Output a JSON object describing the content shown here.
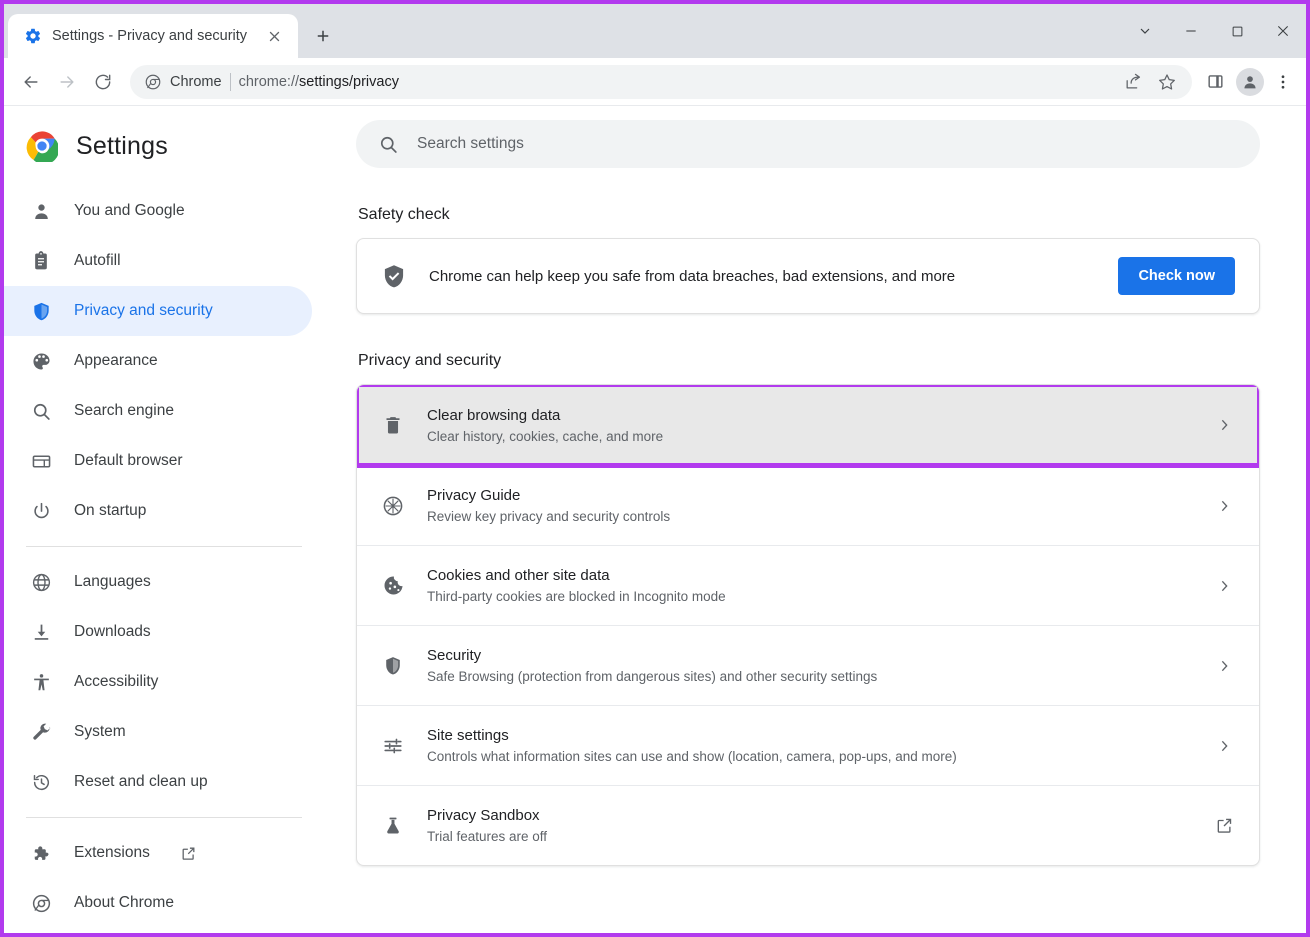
{
  "window": {
    "controls": [
      {
        "name": "tab-search-button",
        "glyph": "chevron-down-icon"
      },
      {
        "name": "minimize-button",
        "glyph": "minimize-icon"
      },
      {
        "name": "maximize-button",
        "glyph": "maximize-icon"
      },
      {
        "name": "close-window-button",
        "glyph": "close-icon"
      }
    ]
  },
  "tab": {
    "title": "Settings - Privacy and security",
    "favicon": "gear-icon",
    "close_label": "×",
    "newtab_label": "+"
  },
  "toolbar": {
    "back_label": "←",
    "forward_label": "→",
    "reload_label": "↻",
    "chip_label": "Chrome",
    "url_scheme": "chrome://",
    "url_path": "settings/privacy",
    "url_full": "chrome://settings/privacy",
    "icons": [
      "share-icon",
      "bookmark-star-icon",
      "side-panel-icon",
      "profile-avatar-icon",
      "more-menu-icon"
    ]
  },
  "sidebar": {
    "brand_title": "Settings",
    "brand_icon": "chrome-logo-icon",
    "groups": [
      {
        "items": [
          {
            "label": "You and Google",
            "icon": "person-icon",
            "active": false
          },
          {
            "label": "Autofill",
            "icon": "clipboard-icon",
            "active": false
          },
          {
            "label": "Privacy and security",
            "icon": "shield-icon",
            "active": true
          },
          {
            "label": "Appearance",
            "icon": "palette-icon",
            "active": false
          },
          {
            "label": "Search engine",
            "icon": "search-icon",
            "active": false
          },
          {
            "label": "Default browser",
            "icon": "browser-window-icon",
            "active": false
          },
          {
            "label": "On startup",
            "icon": "power-icon",
            "active": false
          }
        ]
      },
      {
        "items": [
          {
            "label": "Languages",
            "icon": "globe-icon",
            "active": false
          },
          {
            "label": "Downloads",
            "icon": "download-icon",
            "active": false
          },
          {
            "label": "Accessibility",
            "icon": "accessibility-icon",
            "active": false
          },
          {
            "label": "System",
            "icon": "wrench-icon",
            "active": false
          },
          {
            "label": "Reset and clean up",
            "icon": "history-restore-icon",
            "active": false
          }
        ]
      },
      {
        "items": [
          {
            "label": "Extensions",
            "icon": "puzzle-icon",
            "active": false,
            "external": true
          },
          {
            "label": "About Chrome",
            "icon": "chrome-outline-icon",
            "active": false
          }
        ]
      }
    ]
  },
  "search": {
    "placeholder": "Search settings",
    "value": "",
    "icon": "search-icon"
  },
  "main": {
    "safety_check": {
      "heading": "Safety check",
      "icon": "shield-check-icon",
      "description": "Chrome can help keep you safe from data breaches, bad extensions, and more",
      "button_label": "Check now"
    },
    "privacy": {
      "heading": "Privacy and security",
      "rows": [
        {
          "title": "Clear browsing data",
          "subtitle": "Clear history, cookies, cache, and more",
          "icon": "trash-icon",
          "end_icon": "chevron-right-icon",
          "highlighted": true
        },
        {
          "title": "Privacy Guide",
          "subtitle": "Review key privacy and security controls",
          "icon": "compass-icon",
          "end_icon": "chevron-right-icon",
          "highlighted": false
        },
        {
          "title": "Cookies and other site data",
          "subtitle": "Third-party cookies are blocked in Incognito mode",
          "icon": "cookie-icon",
          "end_icon": "chevron-right-icon",
          "highlighted": false
        },
        {
          "title": "Security",
          "subtitle": "Safe Browsing (protection from dangerous sites) and other security settings",
          "icon": "shield-icon",
          "end_icon": "chevron-right-icon",
          "highlighted": false
        },
        {
          "title": "Site settings",
          "subtitle": "Controls what information sites can use and show (location, camera, pop-ups, and more)",
          "icon": "sliders-icon",
          "end_icon": "chevron-right-icon",
          "highlighted": false
        },
        {
          "title": "Privacy Sandbox",
          "subtitle": "Trial features are off",
          "icon": "flask-icon",
          "end_icon": "external-link-icon",
          "highlighted": false
        }
      ]
    }
  },
  "colors": {
    "annotation_purple": "#b23aee",
    "accent_blue": "#1a73e8",
    "active_pill": "#e8f0fe",
    "highlight_gray": "#e8e8e8"
  }
}
